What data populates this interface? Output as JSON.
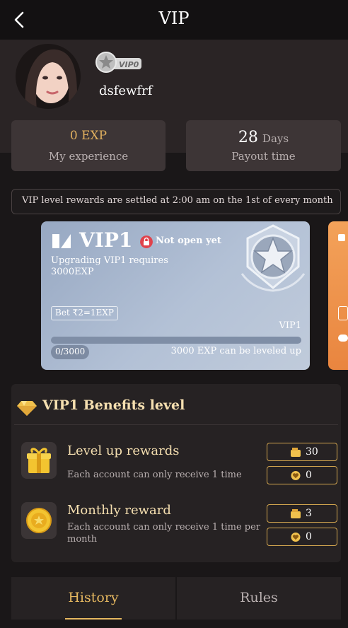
{
  "header": {
    "title": "VIP"
  },
  "profile": {
    "username": "dsfewfrf",
    "vip_badge": "VIP0"
  },
  "stats": {
    "experience_value": "0 EXP",
    "experience_label": "My experience",
    "payout_days": "28",
    "payout_unit": "Days",
    "payout_label": "Payout time"
  },
  "notice": "VIP level rewards are settled at 2:00 am on the 1st of every month",
  "vip_card": {
    "title": "VIP1",
    "status": "Not open yet",
    "requirement_line1": "Upgrading VIP1 requires",
    "requirement_line2": "3000EXP",
    "bet_rate": "Bet ₹2=1EXP",
    "level_label": "VIP1",
    "progress": "0/3000",
    "progress_fraction": 0,
    "levelup_text": "3000 EXP can be leveled up"
  },
  "benefits": {
    "title": "VIP1 Benefits level",
    "items": [
      {
        "title": "Level up rewards",
        "description": "Each account can only receive 1 time",
        "wallet_amount": "30",
        "heart_amount": "0"
      },
      {
        "title": "Monthly reward",
        "description": "Each account can only receive 1 time per month",
        "wallet_amount": "3",
        "heart_amount": "0"
      }
    ]
  },
  "tabs": [
    {
      "label": "History",
      "active": true
    },
    {
      "label": "Rules",
      "active": false
    }
  ],
  "colors": {
    "accent": "#e6b860",
    "background": "#1a1718",
    "panel": "#262223"
  }
}
